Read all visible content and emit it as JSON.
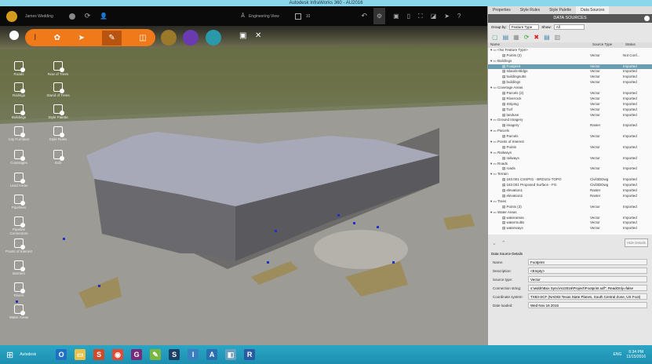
{
  "window": {
    "title": "Autodesk InfraWorks 360 - AU2016"
  },
  "topbar": {
    "user": "James Wedding",
    "view": "Engineering View",
    "count": "10"
  },
  "left_tools": [
    {
      "label": "Roads"
    },
    {
      "label": "Row of Trees"
    },
    {
      "label": "Railings"
    },
    {
      "label": "Stand of Trees"
    },
    {
      "label": "Buildings"
    },
    {
      "label": "Style Palette"
    },
    {
      "label": "City Furniture"
    },
    {
      "label": "Style Rules"
    },
    {
      "label": "Coverages"
    },
    {
      "label": "Edit"
    },
    {
      "label": "Land Areas"
    },
    {
      "label": "Pipelines"
    },
    {
      "label": "Pipeline Connectors"
    },
    {
      "label": "Points of Interest"
    },
    {
      "label": "Barriers"
    },
    {
      "label": "Rivers"
    },
    {
      "label": "Water Areas"
    }
  ],
  "panel": {
    "tabs": [
      "Properties",
      "Style Rules",
      "Style Palette",
      "Data Sources"
    ],
    "active_tab": "Data Sources",
    "header": "DATA SOURCES",
    "group_by_label": "Group by:",
    "group_by_value": "Feature Type",
    "show_label": "Show:",
    "show_value": "All",
    "columns": [
      "Name",
      "Source Type",
      "Status"
    ],
    "rows": [
      {
        "name": "<No Feature Type>",
        "type": "",
        "status": "",
        "level": 0
      },
      {
        "name": "Points (2)",
        "type": "Vector",
        "status": "Not Conf...",
        "level": 1
      },
      {
        "name": "Buildings",
        "type": "",
        "status": "",
        "level": 0
      },
      {
        "name": "Footprint",
        "type": "Vector",
        "status": "Imported",
        "level": 1,
        "selected": true
      },
      {
        "name": "Islands-Bldgs",
        "type": "Vector",
        "status": "Imported",
        "level": 1
      },
      {
        "name": "buildingsutts",
        "type": "Vector",
        "status": "Imported",
        "level": 1
      },
      {
        "name": "buildings",
        "type": "Vector",
        "status": "Imported",
        "level": 1
      },
      {
        "name": "Coverage Areas",
        "type": "",
        "status": "",
        "level": 0
      },
      {
        "name": "Parcels (2)",
        "type": "Vector",
        "status": "Imported",
        "level": 1
      },
      {
        "name": "Riverrock",
        "type": "Vector",
        "status": "Imported",
        "level": 1
      },
      {
        "name": "Striping",
        "type": "Vector",
        "status": "Imported",
        "level": 1
      },
      {
        "name": "Turf",
        "type": "Vector",
        "status": "Imported",
        "level": 1
      },
      {
        "name": "landuse",
        "type": "Vector",
        "status": "Imported",
        "level": 1
      },
      {
        "name": "Ground Imagery",
        "type": "",
        "status": "",
        "level": 0
      },
      {
        "name": "imagery",
        "type": "Raster",
        "status": "Imported",
        "level": 1
      },
      {
        "name": "Parcels",
        "type": "",
        "status": "",
        "level": 0
      },
      {
        "name": "Parcels",
        "type": "Vector",
        "status": "Imported",
        "level": 1
      },
      {
        "name": "Points of Interest",
        "type": "",
        "status": "",
        "level": 0
      },
      {
        "name": "Points",
        "type": "Vector",
        "status": "Imported",
        "level": 1
      },
      {
        "name": "Railways",
        "type": "",
        "status": "",
        "level": 0
      },
      {
        "name": "railways",
        "type": "Vector",
        "status": "Imported",
        "level": 1
      },
      {
        "name": "Roads",
        "type": "",
        "status": "",
        "level": 0
      },
      {
        "name": "roads",
        "type": "Vector",
        "status": "Imported",
        "level": 1
      },
      {
        "name": "Terrain",
        "type": "",
        "status": "",
        "level": 0
      },
      {
        "name": "183.001 CSSP01 - BRD101-TOPO",
        "type": "Civil3DDwg",
        "status": "Imported",
        "level": 1
      },
      {
        "name": "183.001 Proposed Surface - FG",
        "type": "Civil3DDwg",
        "status": "Imported",
        "level": 1
      },
      {
        "name": "elevation1",
        "type": "Raster",
        "status": "Imported",
        "level": 1
      },
      {
        "name": "elevation2",
        "type": "Raster",
        "status": "Imported",
        "level": 1
      },
      {
        "name": "Trees",
        "type": "",
        "status": "",
        "level": 0
      },
      {
        "name": "Points (3)",
        "type": "Vector",
        "status": "Imported",
        "level": 1
      },
      {
        "name": "Water Areas",
        "type": "",
        "status": "",
        "level": 0
      },
      {
        "name": "waterareas",
        "type": "Vector",
        "status": "Imported",
        "level": 1
      },
      {
        "name": "watermultis",
        "type": "Vector",
        "status": "Imported",
        "level": 1
      },
      {
        "name": "waterways",
        "type": "Vector",
        "status": "Imported",
        "level": 1
      }
    ],
    "hide_details": "Hide Details",
    "details_title": "Data Source Details",
    "details": [
      {
        "label": "Name:",
        "value": "Footprint"
      },
      {
        "label": "Description:",
        "value": "<Empty>"
      },
      {
        "label": "Source type:",
        "value": "Vector"
      },
      {
        "label": "Connection string:",
        "value": "s:\\wddn\\Box Sync\\AU2016\\Project\\Footprint.sdf\"; ReadOnly=false"
      },
      {
        "label": "Coordinate system:",
        "value": "TX83-SCF (NAD83 Texas State Planes, South Central Zone, US Foot)"
      },
      {
        "label": "Date loaded:",
        "value": "Wed Nov 16 2016"
      }
    ]
  },
  "taskbar": {
    "start_label": "Autodesk",
    "lang": "ENG",
    "time": "6:34 PM",
    "date": "11/15/2016",
    "apps": [
      {
        "g": "O",
        "c": "#1f6fc5"
      },
      {
        "g": "▭",
        "c": "#e8c24a"
      },
      {
        "g": "S",
        "c": "#d04a2a"
      },
      {
        "g": "◉",
        "c": "#e24a35"
      },
      {
        "g": "G",
        "c": "#7a2a7a"
      },
      {
        "g": "✎",
        "c": "#7ab640"
      },
      {
        "g": "S",
        "c": "#1c3f66"
      },
      {
        "g": "I",
        "c": "#3a80c0"
      },
      {
        "g": "A",
        "c": "#2a70b0"
      },
      {
        "g": "◧",
        "c": "#6aa0c0"
      },
      {
        "g": "R",
        "c": "#2a5aa0"
      }
    ]
  }
}
